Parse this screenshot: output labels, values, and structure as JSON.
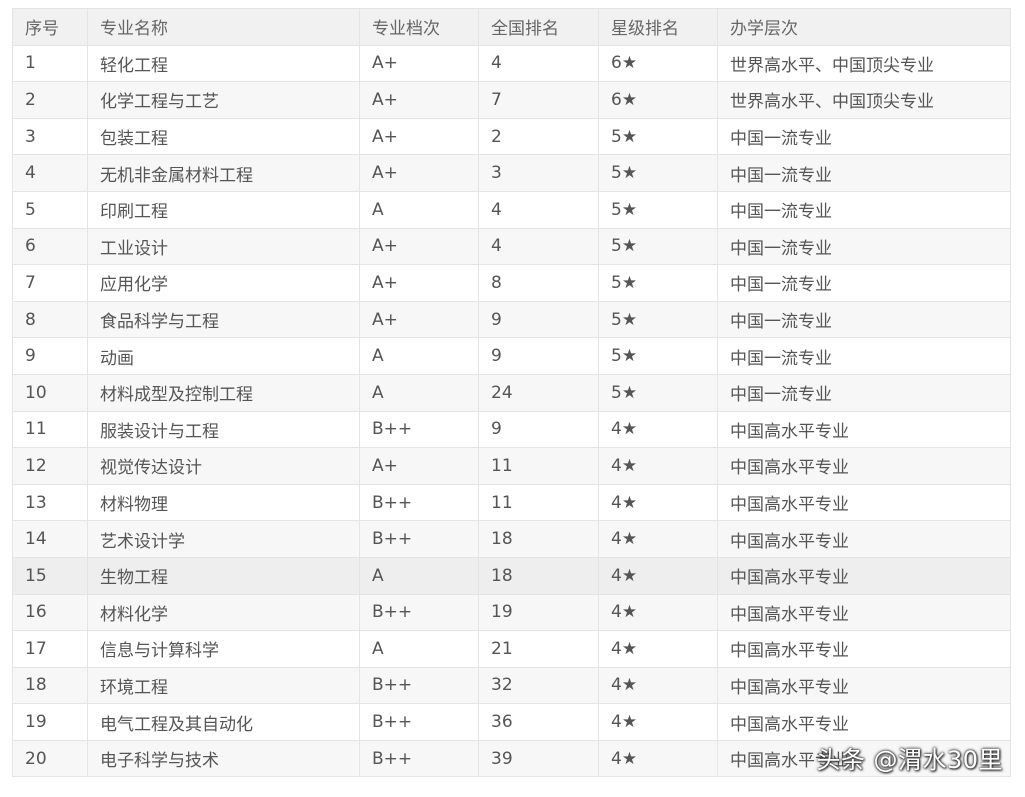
{
  "table": {
    "headers": [
      "序号",
      "专业名称",
      "专业档次",
      "全国排名",
      "星级排名",
      "办学层次"
    ],
    "rows": [
      [
        "1",
        "轻化工程",
        "A+",
        "4",
        "6★",
        "世界高水平、中国顶尖专业"
      ],
      [
        "2",
        "化学工程与工艺",
        "A+",
        "7",
        "6★",
        "世界高水平、中国顶尖专业"
      ],
      [
        "3",
        "包装工程",
        "A+",
        "2",
        "5★",
        "中国一流专业"
      ],
      [
        "4",
        "无机非金属材料工程",
        "A+",
        "3",
        "5★",
        "中国一流专业"
      ],
      [
        "5",
        "印刷工程",
        "A",
        "4",
        "5★",
        "中国一流专业"
      ],
      [
        "6",
        "工业设计",
        "A+",
        "4",
        "5★",
        "中国一流专业"
      ],
      [
        "7",
        "应用化学",
        "A+",
        "8",
        "5★",
        "中国一流专业"
      ],
      [
        "8",
        "食品科学与工程",
        "A+",
        "9",
        "5★",
        "中国一流专业"
      ],
      [
        "9",
        "动画",
        "A",
        "9",
        "5★",
        "中国一流专业"
      ],
      [
        "10",
        "材料成型及控制工程",
        "A",
        "24",
        "5★",
        "中国一流专业"
      ],
      [
        "11",
        "服装设计与工程",
        "B++",
        "9",
        "4★",
        "中国高水平专业"
      ],
      [
        "12",
        "视觉传达设计",
        "A+",
        "11",
        "4★",
        "中国高水平专业"
      ],
      [
        "13",
        "材料物理",
        "B++",
        "11",
        "4★",
        "中国高水平专业"
      ],
      [
        "14",
        "艺术设计学",
        "B++",
        "18",
        "4★",
        "中国高水平专业"
      ],
      [
        "15",
        "生物工程",
        "A",
        "18",
        "4★",
        "中国高水平专业"
      ],
      [
        "16",
        "材料化学",
        "B++",
        "19",
        "4★",
        "中国高水平专业"
      ],
      [
        "17",
        "信息与计算科学",
        "A",
        "21",
        "4★",
        "中国高水平专业"
      ],
      [
        "18",
        "环境工程",
        "B++",
        "32",
        "4★",
        "中国高水平专业"
      ],
      [
        "19",
        "电气工程及其自动化",
        "B++",
        "36",
        "4★",
        "中国高水平专业"
      ],
      [
        "20",
        "电子科学与技术",
        "B++",
        "39",
        "4★",
        "中国高水平专业"
      ]
    ],
    "highlighted_row": 14
  },
  "watermark": "头条 @渭水30里",
  "colors": {
    "header_bg": "#f1f1f1",
    "row_even_bg": "#f7f7f7",
    "row_hover_bg": "#eeeeee",
    "border": "#e4e4e4",
    "text": "#555555"
  }
}
